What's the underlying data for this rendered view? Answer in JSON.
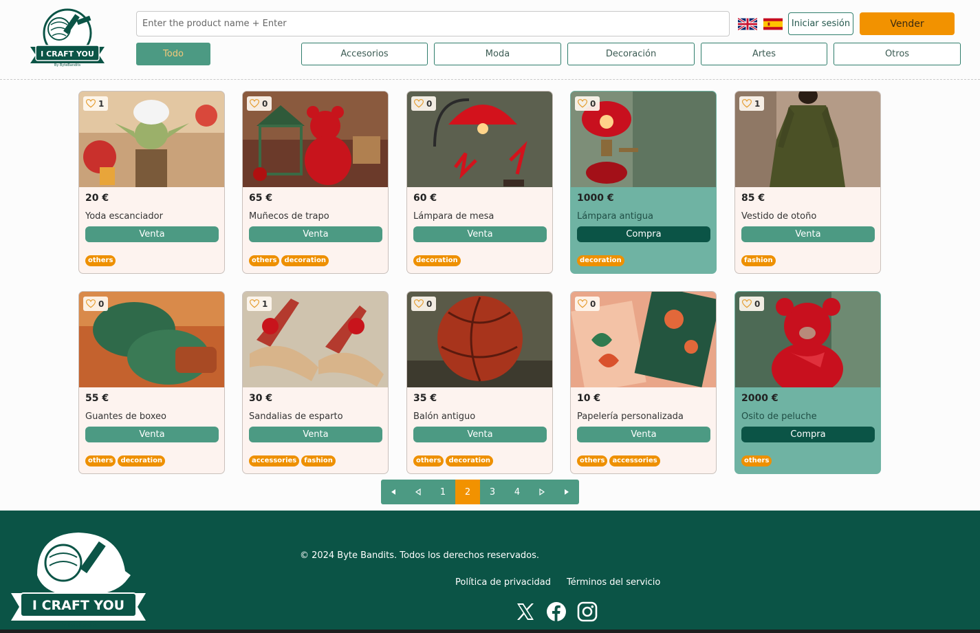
{
  "header": {
    "search_placeholder": "Enter the product name + Enter",
    "login_label": "Iniciar sesión",
    "sell_label": "Vender",
    "categories": [
      "Todo",
      "Accesorios",
      "Moda",
      "Decoración",
      "Artes",
      "Otros"
    ]
  },
  "products": [
    {
      "likes": "1",
      "price": "20 €",
      "name": "Yoda escanciador",
      "action": "Venta",
      "tags": [
        "others"
      ]
    },
    {
      "likes": "0",
      "price": "65 €",
      "name": "Muñecos de trapo",
      "action": "Venta",
      "tags": [
        "others",
        "decoration"
      ]
    },
    {
      "likes": "0",
      "price": "60 €",
      "name": "Lámpara de mesa",
      "action": "Venta",
      "tags": [
        "decoration"
      ]
    },
    {
      "likes": "0",
      "price": "1000 €",
      "name": "Lámpara antigua",
      "action": "Compra",
      "tags": [
        "decoration"
      ]
    },
    {
      "likes": "1",
      "price": "85 €",
      "name": "Vestido de otoño",
      "action": "Venta",
      "tags": [
        "fashion"
      ]
    },
    {
      "likes": "0",
      "price": "55 €",
      "name": "Guantes de boxeo",
      "action": "Venta",
      "tags": [
        "others",
        "decoration"
      ]
    },
    {
      "likes": "1",
      "price": "30 €",
      "name": "Sandalias de esparto",
      "action": "Venta",
      "tags": [
        "accessories",
        "fashion"
      ]
    },
    {
      "likes": "0",
      "price": "35 €",
      "name": "Balón antiguo",
      "action": "Venta",
      "tags": [
        "others",
        "decoration"
      ]
    },
    {
      "likes": "0",
      "price": "10 €",
      "name": "Papelería personalizada",
      "action": "Venta",
      "tags": [
        "others",
        "accessories"
      ]
    },
    {
      "likes": "0",
      "price": "2000 €",
      "name": "Osito de peluche",
      "action": "Compra",
      "tags": [
        "others"
      ]
    }
  ],
  "pagination": {
    "pages": [
      "1",
      "2",
      "3",
      "4"
    ],
    "current": "2"
  },
  "footer": {
    "copyright": "© 2024 Byte Bandits. Todos los derechos reservados.",
    "privacy": "Política de privacidad",
    "terms": "Términos del servicio",
    "social_icons": [
      "x-icon",
      "facebook-icon",
      "instagram-icon"
    ]
  },
  "logo": {
    "text": "I CRAFT YOU",
    "byline": "By ByteBandits"
  },
  "colors": {
    "primary": "#4c9a83",
    "dark": "#0b5446",
    "accent": "#f29200",
    "card_bg": "#fdf3ef",
    "card_buy_bg": "#6fb3a3"
  }
}
